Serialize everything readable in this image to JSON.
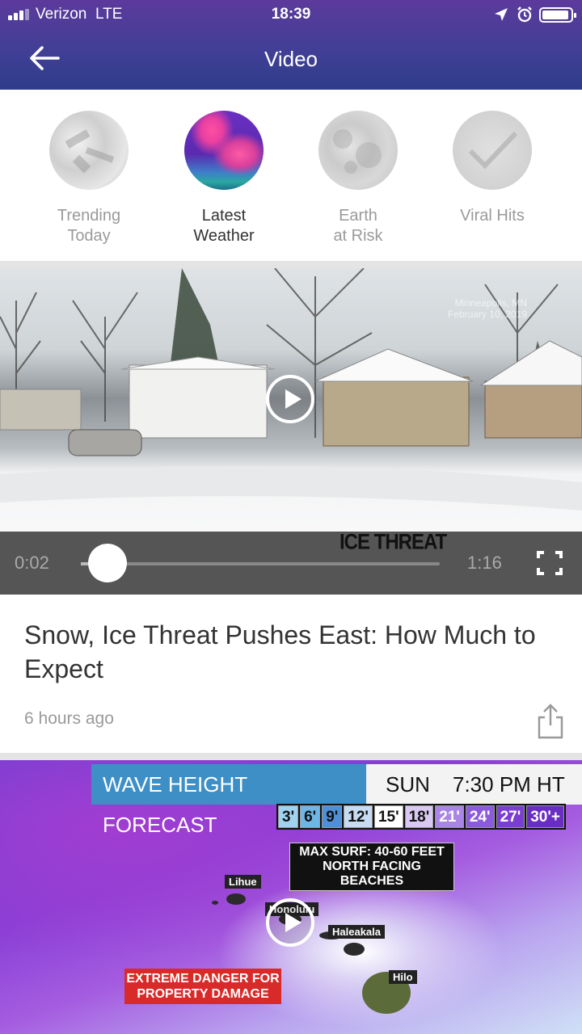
{
  "status_bar": {
    "carrier": "Verizon",
    "network": "LTE",
    "time": "18:39"
  },
  "nav": {
    "title": "Video",
    "back_icon": "arrow-left-icon"
  },
  "categories": [
    {
      "line1": "Trending",
      "line2": "Today",
      "active": false
    },
    {
      "line1": "Latest",
      "line2": "Weather",
      "active": true
    },
    {
      "line1": "Earth",
      "line2": "at Risk",
      "active": false
    },
    {
      "line1": "Viral Hits",
      "line2": "",
      "active": false
    }
  ],
  "video1": {
    "watermark_line1": "Minneapolis, MN",
    "watermark_line2": "February 10, 2019",
    "ticker": "ICE THREAT",
    "current_time": "0:02",
    "duration": "1:16",
    "progress": 0.03
  },
  "article": {
    "title": "Snow, Ice Threat Pushes East: How Much to Expect",
    "age": "6 hours ago"
  },
  "video2": {
    "banner": "WAVE HEIGHT FORECAST",
    "day": "SUN",
    "time": "7:30 PM HT",
    "legend": [
      "3'",
      "6'",
      "9'",
      "12'",
      "15'",
      "18'",
      "21'",
      "24'",
      "27'",
      "30'+"
    ],
    "legend_colors": [
      "#9fd3f0",
      "#6fb6e6",
      "#4f8fd8",
      "#c7dcf3",
      "#ffffff",
      "#d9c9f2",
      "#a986e6",
      "#8b5bdc",
      "#7a3fd0",
      "#6a2dc4"
    ],
    "surf_line1": "MAX SURF: 40-60 FEET",
    "surf_line2": "NORTH FACING BEACHES",
    "places": [
      "Lihue",
      "Honolulu",
      "Haleakala",
      "Hilo"
    ],
    "danger_line1": "EXTREME DANGER FOR",
    "danger_line2": "PROPERTY DAMAGE"
  }
}
